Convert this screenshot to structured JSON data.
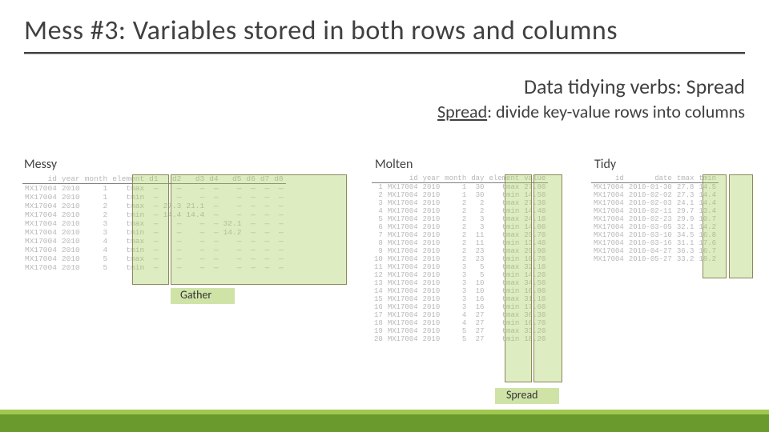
{
  "title": "Mess #3: Variables stored in both rows and columns",
  "subtitle": "Data tidying verbs: Spread",
  "desc_verb": "Spread",
  "desc_rest": ": divide key-value rows into columns",
  "labels": {
    "messy": "Messy",
    "molten": "Molten",
    "tidy": "Tidy",
    "gather": "Gather",
    "spread": "Spread"
  },
  "messy": {
    "headers": [
      "id",
      "year",
      "month",
      "element",
      "d1",
      "d2",
      "d3",
      "d4",
      "d5",
      "d6",
      "d7",
      "d8"
    ],
    "rows": [
      [
        "MX17004",
        "2010",
        "1",
        "tmax",
        "—",
        "—",
        "—",
        "—",
        "—",
        "—",
        "—",
        "—"
      ],
      [
        "MX17004",
        "2010",
        "1",
        "tmin",
        "—",
        "—",
        "—",
        "—",
        "—",
        "—",
        "—",
        "—"
      ],
      [
        "MX17004",
        "2010",
        "2",
        "tmax",
        "—",
        "27.3",
        "21.1",
        "—",
        "—",
        "—",
        "—",
        "—"
      ],
      [
        "MX17004",
        "2010",
        "2",
        "tmin",
        "—",
        "14.4",
        "14.4",
        "—",
        "—",
        "—",
        "—",
        "—"
      ],
      [
        "MX17004",
        "2010",
        "3",
        "tmax",
        "—",
        "—",
        "—",
        "—",
        "32.1",
        "—",
        "—",
        "—"
      ],
      [
        "MX17004",
        "2010",
        "3",
        "tmin",
        "—",
        "—",
        "—",
        "—",
        "14.2",
        "—",
        "—",
        "—"
      ],
      [
        "MX17004",
        "2010",
        "4",
        "tmax",
        "—",
        "—",
        "—",
        "—",
        "—",
        "—",
        "—",
        "—"
      ],
      [
        "MX17004",
        "2010",
        "4",
        "tmin",
        "—",
        "—",
        "—",
        "—",
        "—",
        "—",
        "—",
        "—"
      ],
      [
        "MX17004",
        "2010",
        "5",
        "tmax",
        "—",
        "—",
        "—",
        "—",
        "—",
        "—",
        "—",
        "—"
      ],
      [
        "MX17004",
        "2010",
        "5",
        "tmin",
        "—",
        "—",
        "—",
        "—",
        "—",
        "—",
        "—",
        "—"
      ]
    ]
  },
  "molten": {
    "headers": [
      "",
      "id",
      "year",
      "month",
      "day",
      "element",
      "value"
    ],
    "rows": [
      [
        "1",
        "MX17004",
        "2010",
        "1",
        "30",
        "tmax",
        "27.80"
      ],
      [
        "2",
        "MX17004",
        "2010",
        "1",
        "30",
        "tmin",
        "14.50"
      ],
      [
        "3",
        "MX17004",
        "2010",
        "2",
        "2",
        "tmax",
        "27.30"
      ],
      [
        "4",
        "MX17004",
        "2010",
        "2",
        "2",
        "tmin",
        "14.40"
      ],
      [
        "5",
        "MX17004",
        "2010",
        "2",
        "3",
        "tmax",
        "24.10"
      ],
      [
        "6",
        "MX17004",
        "2010",
        "2",
        "3",
        "tmin",
        "14.00"
      ],
      [
        "7",
        "MX17004",
        "2010",
        "2",
        "11",
        "tmax",
        "29.70"
      ],
      [
        "8",
        "MX17004",
        "2010",
        "2",
        "11",
        "tmin",
        "13.40"
      ],
      [
        "9",
        "MX17004",
        "2010",
        "2",
        "23",
        "tmax",
        "29.90"
      ],
      [
        "10",
        "MX17004",
        "2010",
        "2",
        "23",
        "tmin",
        "10.70"
      ],
      [
        "11",
        "MX17004",
        "2010",
        "3",
        "5",
        "tmax",
        "32.10"
      ],
      [
        "12",
        "MX17004",
        "2010",
        "3",
        "5",
        "tmin",
        "14.20"
      ],
      [
        "13",
        "MX17004",
        "2010",
        "3",
        "10",
        "tmax",
        "34.50"
      ],
      [
        "14",
        "MX17004",
        "2010",
        "3",
        "10",
        "tmin",
        "16.80"
      ],
      [
        "15",
        "MX17004",
        "2010",
        "3",
        "16",
        "tmax",
        "31.10"
      ],
      [
        "16",
        "MX17004",
        "2010",
        "3",
        "16",
        "tmin",
        "17.60"
      ],
      [
        "17",
        "MX17004",
        "2010",
        "4",
        "27",
        "tmax",
        "36.30"
      ],
      [
        "18",
        "MX17004",
        "2010",
        "4",
        "27",
        "tmin",
        "16.70"
      ],
      [
        "19",
        "MX17004",
        "2010",
        "5",
        "27",
        "tmax",
        "33.20"
      ],
      [
        "20",
        "MX17004",
        "2010",
        "5",
        "27",
        "tmin",
        "18.20"
      ]
    ]
  },
  "tidy": {
    "headers": [
      "id",
      "date",
      "tmax",
      "tmin"
    ],
    "rows": [
      [
        "MX17004",
        "2010-01-30",
        "27.8",
        "14.5"
      ],
      [
        "MX17004",
        "2010-02-02",
        "27.3",
        "14.4"
      ],
      [
        "MX17004",
        "2010-02-03",
        "24.1",
        "14.4"
      ],
      [
        "MX17004",
        "2010-02-11",
        "29.7",
        "13.4"
      ],
      [
        "MX17004",
        "2010-02-23",
        "29.9",
        "10.7"
      ],
      [
        "MX17004",
        "2010-03-05",
        "32.1",
        "14.2"
      ],
      [
        "MX17004",
        "2010-03-10",
        "34.5",
        "16.8"
      ],
      [
        "MX17004",
        "2010-03-16",
        "31.1",
        "17.6"
      ],
      [
        "MX17004",
        "2010-04-27",
        "36.3",
        "16.7"
      ],
      [
        "MX17004",
        "2010-05-27",
        "33.2",
        "18.2"
      ]
    ]
  }
}
